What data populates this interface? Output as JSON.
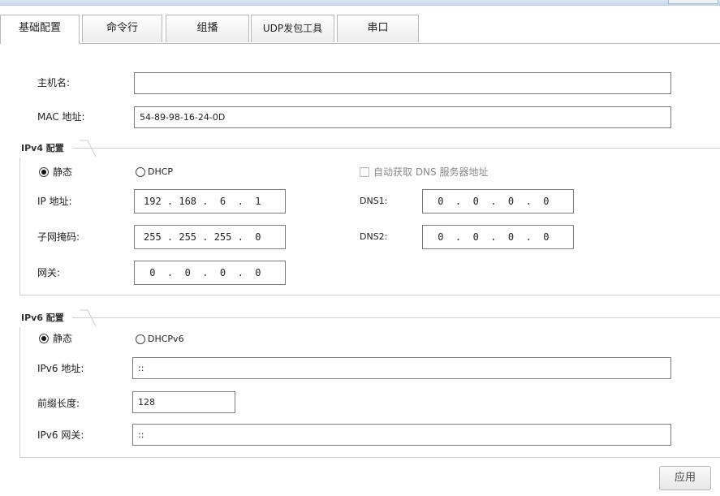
{
  "tabs": [
    "基础配置",
    "命令行",
    "组播",
    "UDP发包工具",
    "串口"
  ],
  "basic": {
    "hostname_label": "主机名:",
    "hostname_value": "",
    "mac_label": "MAC 地址:",
    "mac_value": "54-89-98-16-24-0D"
  },
  "ipv4": {
    "legend": "IPv4 配置",
    "static_label": "静态",
    "dhcp_label": "DHCP",
    "selected_mode": "static",
    "auto_dns_label": "自动获取 DNS 服务器地址",
    "ip_label": "IP 地址:",
    "ip_value": "192 . 168 .  6  .  1",
    "mask_label": "子网掩码:",
    "mask_value": "255 . 255 . 255 .  0",
    "gateway_label": "网关:",
    "gateway_value": " 0  .  0  .  0  .  0",
    "dns1_label": "DNS1:",
    "dns1_value": " 0  .  0  .  0  .  0",
    "dns2_label": "DNS2:",
    "dns2_value": " 0  .  0  .  0  .  0"
  },
  "ipv6": {
    "legend": "IPv6 配置",
    "static_label": "静态",
    "dhcp_label": "DHCPv6",
    "selected_mode": "static",
    "addr_label": "IPv6 地址:",
    "addr_value": "::",
    "prefix_label": "前缀长度:",
    "prefix_value": "128",
    "gateway_label": "IPv6 网关:",
    "gateway_value": "::"
  },
  "apply_label": "应用"
}
